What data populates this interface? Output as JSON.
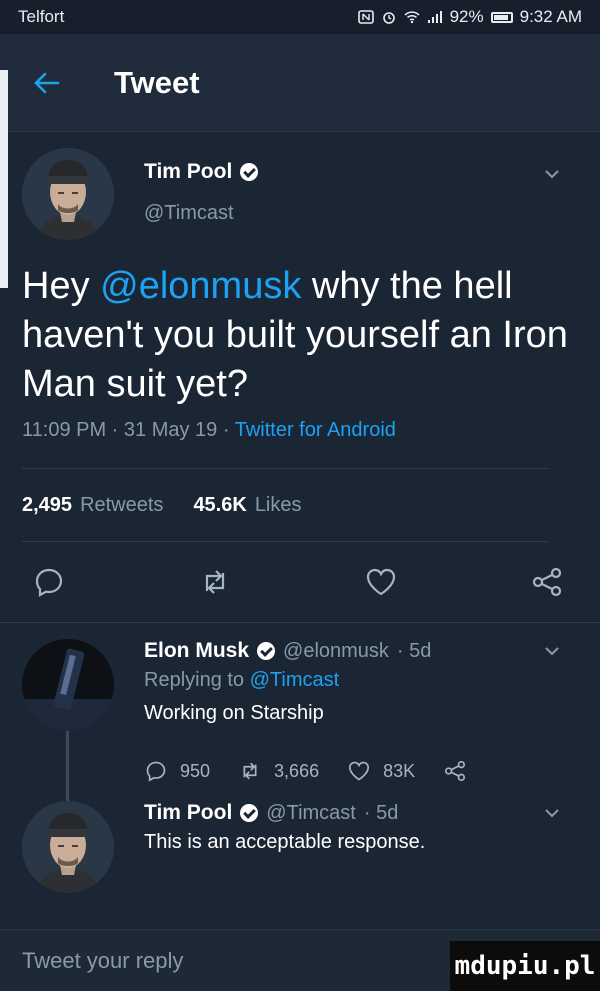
{
  "status_bar": {
    "carrier": "Telfort",
    "battery_percent": "92%",
    "time": "9:32 AM"
  },
  "app_bar": {
    "title": "Tweet"
  },
  "tweet": {
    "author_name": "Tim Pool",
    "author_handle": "@Timcast",
    "text_before": "Hey ",
    "mention": "@elonmusk",
    "text_after": " why the hell haven't you built yourself an Iron Man suit yet?",
    "timestamp": "11:09 PM · 31 May 19 · ",
    "source": "Twitter for Android",
    "retweets_count": "2,495",
    "retweets_label": "Retweets",
    "likes_count": "45.6K",
    "likes_label": "Likes"
  },
  "replies": [
    {
      "author_name": "Elon Musk",
      "author_handle": "@elonmusk",
      "age": "· 5d",
      "replying_prefix": "Replying to ",
      "replying_to": "@Timcast",
      "text": "Working on Starship",
      "reply_count": "950",
      "retweet_count": "3,666",
      "like_count": "83K"
    },
    {
      "author_name": "Tim Pool",
      "author_handle": "@Timcast",
      "age": "· 5d",
      "text": "This is an acceptable response."
    }
  ],
  "compose": {
    "placeholder": "Tweet your reply"
  },
  "watermark": "mdupiu.pl",
  "colors": {
    "background": "#1b2634",
    "accent": "#1da1f2",
    "muted_text": "#8899a8"
  }
}
